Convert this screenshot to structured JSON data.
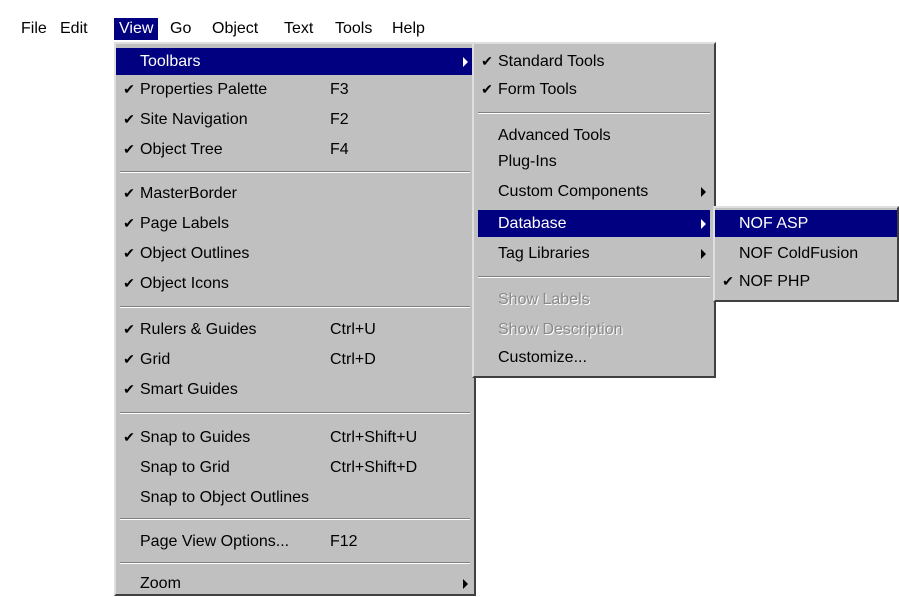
{
  "menubar": {
    "items": [
      {
        "label": "File",
        "active": false
      },
      {
        "label": "Edit",
        "active": false
      },
      {
        "label": "View",
        "active": true
      },
      {
        "label": "Go",
        "active": false
      },
      {
        "label": "Object",
        "active": false
      },
      {
        "label": "Text",
        "active": false
      },
      {
        "label": "Tools",
        "active": false
      },
      {
        "label": "Help",
        "active": false
      }
    ]
  },
  "view_menu": {
    "items": [
      {
        "label": "Toolbars",
        "checked": false,
        "shortcut": "",
        "submenu": true,
        "highlighted": true
      },
      {
        "label": "Properties Palette",
        "checked": true,
        "shortcut": "F3"
      },
      {
        "label": "Site Navigation",
        "checked": true,
        "shortcut": "F2"
      },
      {
        "label": "Object Tree",
        "checked": true,
        "shortcut": "F4"
      },
      {
        "label": "MasterBorder",
        "checked": true,
        "shortcut": ""
      },
      {
        "label": "Page Labels",
        "checked": true,
        "shortcut": ""
      },
      {
        "label": "Object Outlines",
        "checked": true,
        "shortcut": ""
      },
      {
        "label": "Object Icons",
        "checked": true,
        "shortcut": ""
      },
      {
        "label": "Rulers & Guides",
        "checked": true,
        "shortcut": "Ctrl+U"
      },
      {
        "label": "Grid",
        "checked": true,
        "shortcut": "Ctrl+D"
      },
      {
        "label": "Smart Guides",
        "checked": true,
        "shortcut": ""
      },
      {
        "label": "Snap to Guides",
        "checked": true,
        "shortcut": "Ctrl+Shift+U"
      },
      {
        "label": "Snap to Grid",
        "checked": false,
        "shortcut": "Ctrl+Shift+D"
      },
      {
        "label": "Snap to Object Outlines",
        "checked": false,
        "shortcut": ""
      },
      {
        "label": "Page View Options...",
        "checked": false,
        "shortcut": "F12"
      },
      {
        "label": "Zoom",
        "checked": false,
        "shortcut": "",
        "submenu": true
      }
    ]
  },
  "toolbars_menu": {
    "items": [
      {
        "label": "Standard Tools",
        "checked": true
      },
      {
        "label": "Form Tools",
        "checked": true
      },
      {
        "label": "Advanced Tools",
        "checked": false
      },
      {
        "label": "Plug-Ins",
        "checked": false
      },
      {
        "label": "Custom Components",
        "checked": false,
        "submenu": true
      },
      {
        "label": "Database",
        "checked": false,
        "submenu": true,
        "highlighted": true
      },
      {
        "label": "Tag Libraries",
        "checked": false,
        "submenu": true
      },
      {
        "label": "Show Labels",
        "checked": false,
        "disabled": true
      },
      {
        "label": "Show Description",
        "checked": false,
        "disabled": true
      },
      {
        "label": "Customize...",
        "checked": false
      }
    ]
  },
  "database_menu": {
    "items": [
      {
        "label": "NOF ASP",
        "checked": false,
        "highlighted": true
      },
      {
        "label": "NOF ColdFusion",
        "checked": false
      },
      {
        "label": "NOF PHP",
        "checked": true
      }
    ]
  },
  "glyphs": {
    "check": "✔"
  }
}
